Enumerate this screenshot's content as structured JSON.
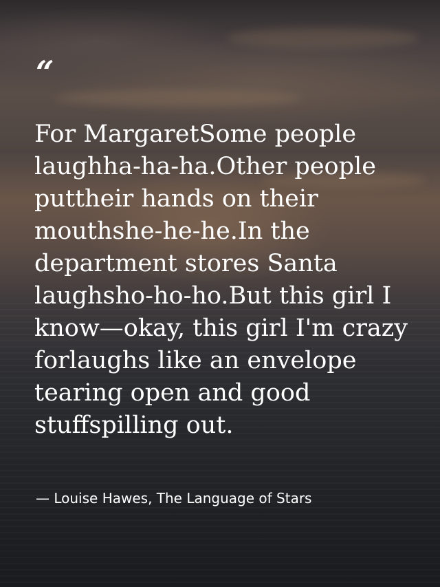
{
  "quote": {
    "mark": "“",
    "text": "For MargaretSome people laughha-ha-ha.Other people puttheir hands on their mouthshe-he-he.In the department stores Santa laughsho-ho-ho.But this girl I know—okay, this girl I'm crazy forlaughs like an envelope tearing open and good stuffspilling out.",
    "attribution": "— Louise Hawes, The Language of Stars"
  },
  "colors": {
    "text": "#ffffff",
    "sky_warm": "#6a5649",
    "sea_dark": "#1a1b1f"
  }
}
